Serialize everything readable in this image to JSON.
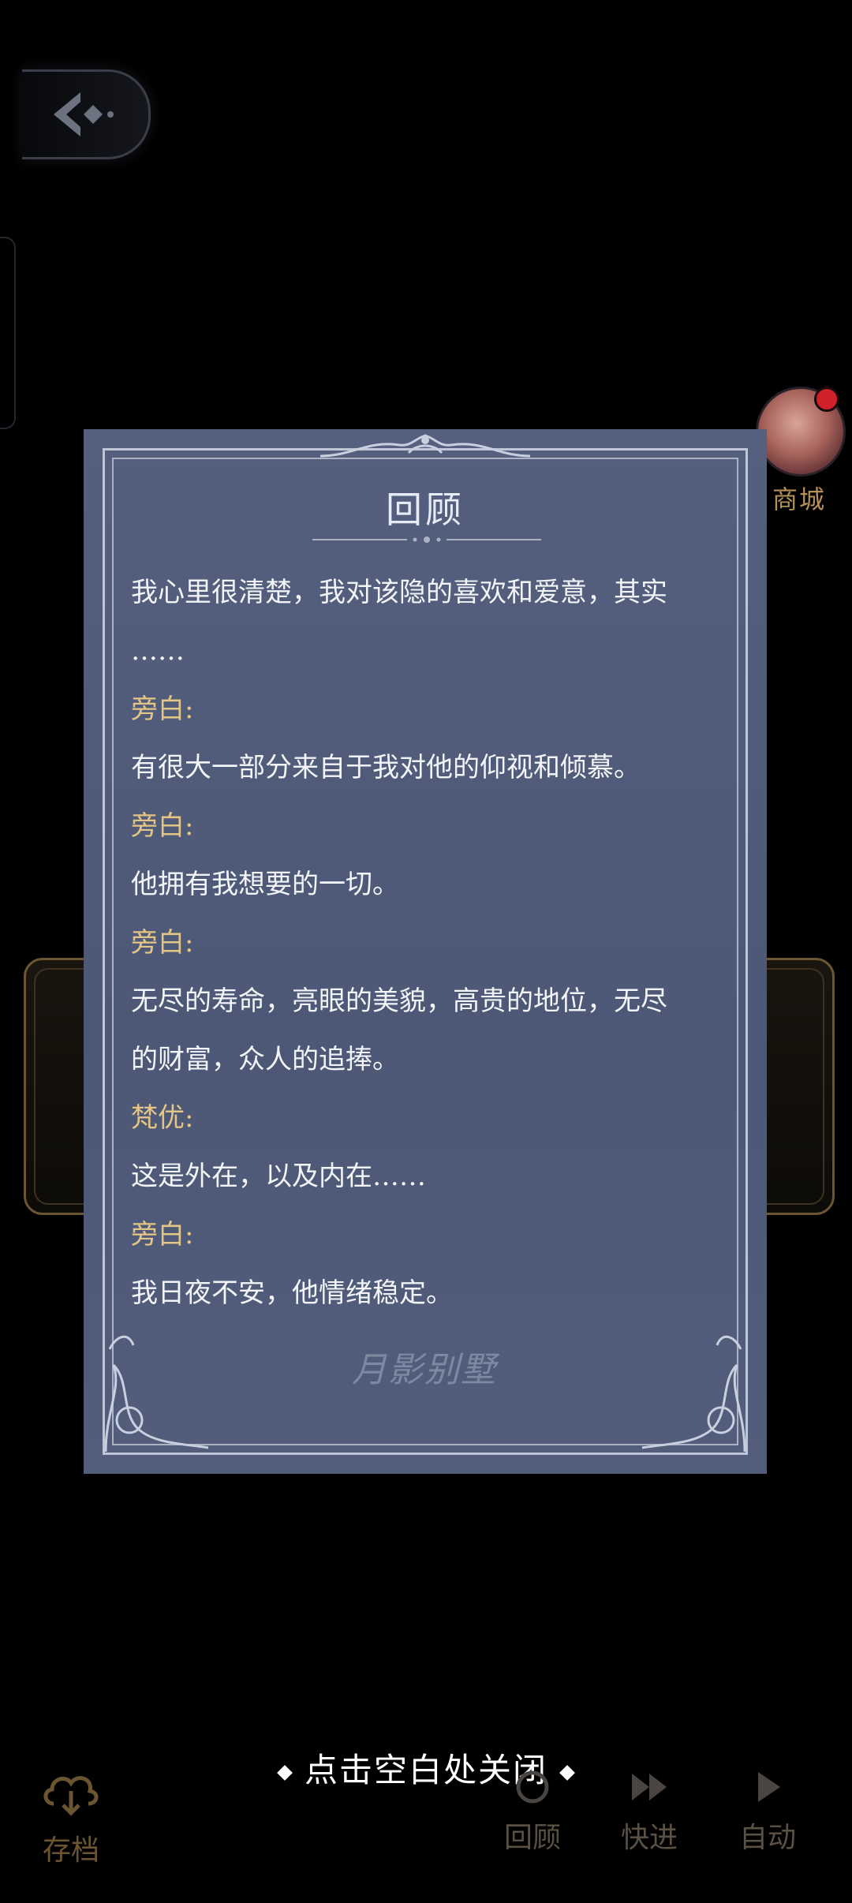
{
  "shop": {
    "label": "商城"
  },
  "review": {
    "title": "回顾",
    "entries": [
      {
        "type": "text",
        "text": "我心里很清楚，我对该隐的喜欢和爱意，其实"
      },
      {
        "type": "text",
        "text": "……"
      },
      {
        "type": "speaker",
        "text": "旁白:"
      },
      {
        "type": "text",
        "text": "有很大一部分来自于我对他的仰视和倾慕。"
      },
      {
        "type": "speaker",
        "text": "旁白:"
      },
      {
        "type": "text",
        "text": "他拥有我想要的一切。"
      },
      {
        "type": "speaker",
        "text": "旁白:"
      },
      {
        "type": "text",
        "text": "无尽的寿命，亮眼的美貌，高贵的地位，无尽"
      },
      {
        "type": "text",
        "text": "的财富，众人的追捧。"
      },
      {
        "type": "speaker",
        "text": "梵优:"
      },
      {
        "type": "text",
        "text": "这是外在，以及内在……"
      },
      {
        "type": "speaker",
        "text": "旁白:"
      },
      {
        "type": "text",
        "text": "我日夜不安，他情绪稳定。"
      }
    ],
    "watermark": "月影别墅"
  },
  "close_hint": "点击空白处关闭",
  "bottom_bar": {
    "save_label": "存档",
    "review_label": "回顾",
    "fast_forward_label": "快进",
    "auto_label": "自动"
  },
  "colors": {
    "panel": "#4e5a78",
    "speaker": "#e4c585",
    "gold": "#b59158"
  }
}
